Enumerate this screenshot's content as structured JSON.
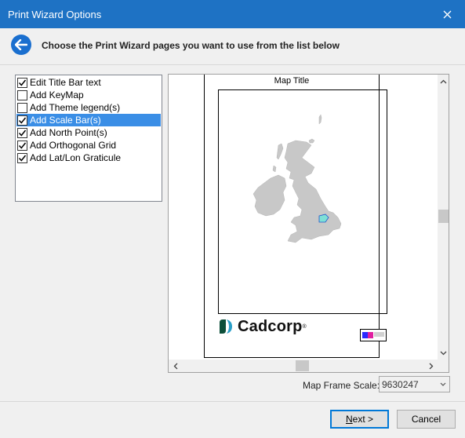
{
  "window": {
    "title": "Print Wizard Options",
    "close_icon": "close-icon"
  },
  "header": {
    "instruction": "Choose the Print Wizard pages you want to use from the list below",
    "back_icon": "back-arrow-icon"
  },
  "pages": [
    {
      "label": "Edit Title Bar text",
      "checked": true,
      "selected": false
    },
    {
      "label": "Add KeyMap",
      "checked": false,
      "selected": false
    },
    {
      "label": "Add Theme legend(s)",
      "checked": false,
      "selected": false
    },
    {
      "label": "Add Scale Bar(s)",
      "checked": true,
      "selected": true
    },
    {
      "label": "Add North Point(s)",
      "checked": true,
      "selected": false
    },
    {
      "label": "Add Orthogonal Grid",
      "checked": true,
      "selected": false
    },
    {
      "label": "Add Lat/Lon Graticule",
      "checked": true,
      "selected": false
    }
  ],
  "preview": {
    "map_title": "Map Title",
    "logo_text": "Cadcorp",
    "logo_mark": "®"
  },
  "map_frame_scale": {
    "label": "Map Frame Scale:",
    "value": "9630247"
  },
  "buttons": {
    "next_accel": "N",
    "next_rest": "ext >",
    "cancel": "Cancel"
  },
  "colors": {
    "titlebar": "#1e72c4",
    "selection": "#3a8ee6",
    "land": "#c8c8c8",
    "highlight_area": "#7ee0d6"
  }
}
